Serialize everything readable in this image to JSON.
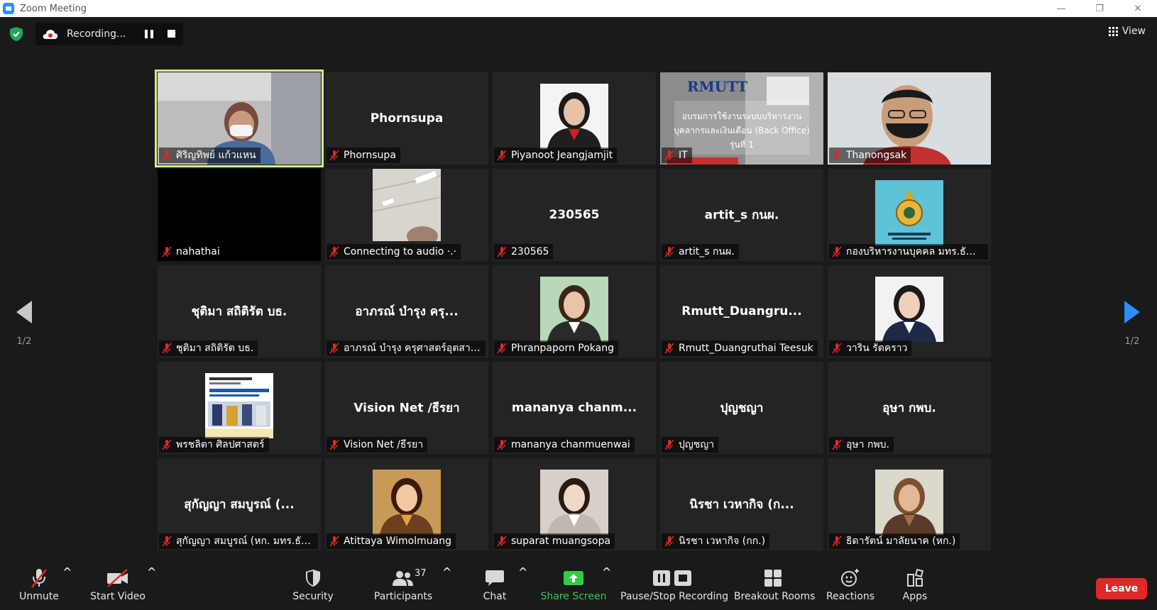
{
  "window": {
    "title": "Zoom Meeting",
    "minimize": "—",
    "maximize": "❐",
    "close": "✕"
  },
  "recording": {
    "status": "Recording..."
  },
  "view_label": "View",
  "pagination": {
    "left_page": "1/2",
    "right_page": "1/2"
  },
  "tiles": [
    {
      "label": "ศิริญทิพย์ แก้วแหน",
      "center": "",
      "video": "webcam-masked",
      "speaking": true
    },
    {
      "label": "Phornsupa",
      "center": "Phornsupa",
      "video": "none"
    },
    {
      "label": "Piyanoot Jeangjamjit",
      "center": "",
      "video": "profile-photo"
    },
    {
      "label": "IT",
      "center": "",
      "video": "slide",
      "slide_text": [
        "อบรมการใช้งานระบบบริหารงาน",
        "บุคลากรและเงินเดือน (Back Office)",
        "รุ่นที่ 1"
      ],
      "slide_brand": "RMUTT"
    },
    {
      "label": "Thanongsak",
      "center": "",
      "video": "webcam-masked-man"
    },
    {
      "label": "nahathai",
      "center": "",
      "video": "black"
    },
    {
      "label": "Connecting to audio ·.·",
      "center": "",
      "video": "ceiling"
    },
    {
      "label": "230565",
      "center": "230565",
      "video": "none"
    },
    {
      "label": "artit_s กนผ.",
      "center": "artit_s กนผ.",
      "video": "none"
    },
    {
      "label": "กองบริหารงานบุคคล มทร.ธัญบุรี",
      "center": "",
      "video": "logo"
    },
    {
      "label": "ชุติมา สถิติรัต บธ.",
      "center": "ชุติมา  สถิติรัต  บธ.",
      "video": "none"
    },
    {
      "label": "อาภรณ์ บำรุง ครุศาสตร์อุตสาห...",
      "center": "อาภรณ์ บำรุง ครุ...",
      "video": "none"
    },
    {
      "label": "Phranpaporn Pokang",
      "center": "",
      "video": "profile-photo-2"
    },
    {
      "label": "Rmutt_Duangruthai Teesuk",
      "center": "Rmutt_Duangru...",
      "video": "none"
    },
    {
      "label": "วาริน รัตคราว",
      "center": "",
      "video": "profile-photo-3"
    },
    {
      "label": "พรชลิตา ศิลปศาสตร์",
      "center": "",
      "video": "document"
    },
    {
      "label": "Vision Net /ธีรยา",
      "center": "Vision Net /ธีรยา",
      "video": "none"
    },
    {
      "label": "mananya chanmuenwai",
      "center": "mananya  chanm...",
      "video": "none"
    },
    {
      "label": "ปุญชญา",
      "center": "ปุญชญา",
      "video": "none"
    },
    {
      "label": "อุษา กพบ.",
      "center": "อุษา กพบ.",
      "video": "none"
    },
    {
      "label": "สุกัญญา สมบูรณ์ (หก. มทร.ธัญ...",
      "center": "สุกัญญา สมบูรณ์ (...",
      "video": "none"
    },
    {
      "label": "Atittaya Wimolmuang",
      "center": "",
      "video": "profile-photo-4"
    },
    {
      "label": "suparat muangsopa",
      "center": "",
      "video": "profile-photo-5"
    },
    {
      "label": "นิรชา เวหากิจ (กก.)",
      "center": "นิรชา  เวหากิจ (ก...",
      "video": "none"
    },
    {
      "label": "ธิดารัตน์ มาลัยนาค (หก.)",
      "center": "",
      "video": "profile-photo-6"
    }
  ],
  "toolbar": {
    "unmute": "Unmute",
    "start_video": "Start Video",
    "security": "Security",
    "participants": "Participants",
    "participants_count": "37",
    "chat": "Chat",
    "share_screen": "Share Screen",
    "pause_stop_recording": "Pause/Stop Recording",
    "breakout_rooms": "Breakout Rooms",
    "reactions": "Reactions",
    "apps": "Apps",
    "leave": "Leave"
  },
  "colors": {
    "accent_green": "#33cc44",
    "leave_red": "#e02828",
    "speaking_outline": "#d6ef7d",
    "zoom_blue": "#2d8cff"
  }
}
